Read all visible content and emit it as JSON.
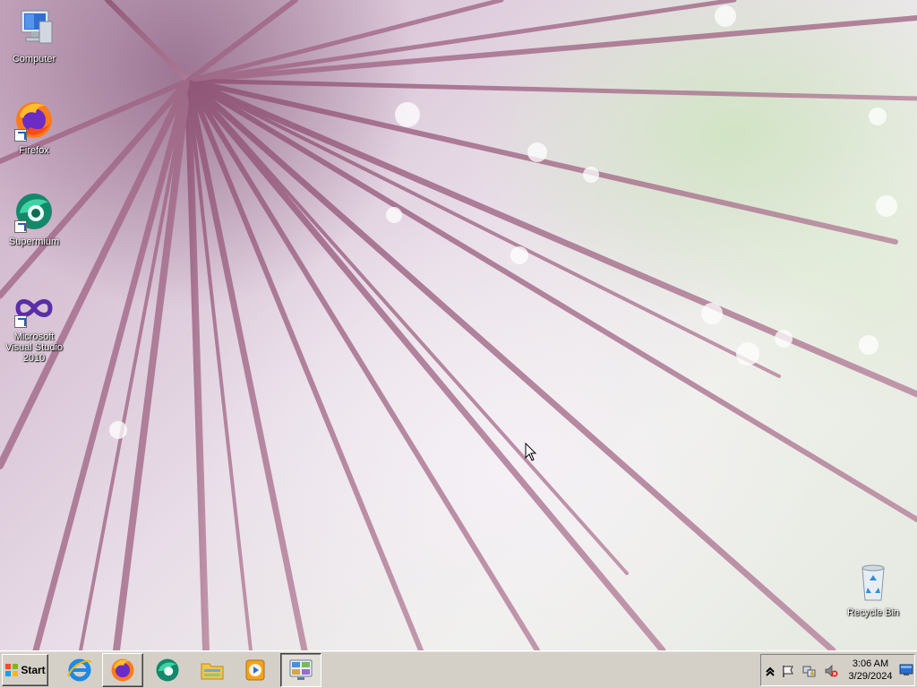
{
  "desktop": {
    "icons": [
      {
        "label": "Computer",
        "icon": "computer-icon"
      },
      {
        "label": "Firefox",
        "icon": "firefox-icon"
      },
      {
        "label": "Supermium",
        "icon": "supermium-icon"
      },
      {
        "label": "Microsoft Visual Studio 2010",
        "icon": "visual-studio-icon"
      },
      {
        "label": "Recycle Bin",
        "icon": "recycle-bin-icon"
      }
    ]
  },
  "taskbar": {
    "start_label": "Start",
    "pinned": [
      {
        "name": "internet-explorer",
        "icon": "internet-explorer-icon"
      },
      {
        "name": "firefox",
        "icon": "firefox-icon"
      },
      {
        "name": "supermium",
        "icon": "supermium-icon"
      },
      {
        "name": "file-explorer",
        "icon": "folder-icon"
      },
      {
        "name": "media-player",
        "icon": "media-player-icon"
      },
      {
        "name": "control-panel",
        "icon": "control-panel-icon"
      }
    ],
    "tray": {
      "icons": [
        "show-hidden-icons-chevron",
        "action-center-flag-icon",
        "network-icon",
        "volume-muted-icon"
      ],
      "time": "3:06 AM",
      "date": "3/29/2024"
    }
  },
  "colors": {
    "taskbar": "#d4d0c8",
    "desktop_text": "#ffffff"
  }
}
